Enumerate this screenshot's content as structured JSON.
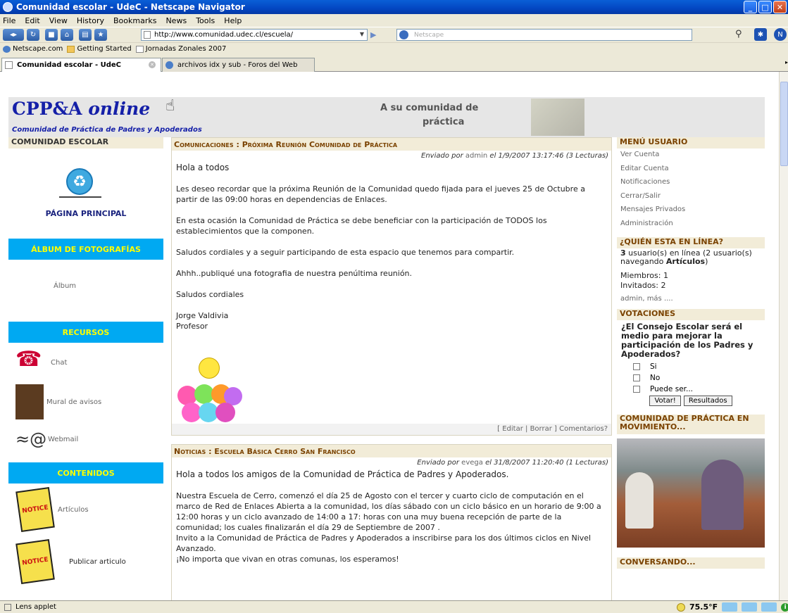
{
  "window": {
    "title": "Comunidad escolar - UdeC - Netscape Navigator"
  },
  "menu": [
    "File",
    "Edit",
    "View",
    "History",
    "Bookmarks",
    "News",
    "Tools",
    "Help"
  ],
  "address": {
    "url": "http://www.comunidad.udec.cl/escuela/",
    "search_placeholder": "Netscape"
  },
  "bookmarks": [
    {
      "label": "Netscape.com",
      "icon": "globe-icon"
    },
    {
      "label": "Getting Started",
      "icon": "folder-icon"
    },
    {
      "label": "Jornadas Zonales 2007",
      "icon": "page-icon"
    }
  ],
  "tabs": [
    {
      "label": "Comunidad escolar - UdeC",
      "active": true
    },
    {
      "label": "archivos idx y sub - Foros del Web",
      "active": false
    }
  ],
  "header": {
    "logo_main": "CPP&A",
    "logo_italic": "online",
    "logo_sub": "Comunidad de Práctica de Padres y Apoderados",
    "banner_line1": "A su comunidad de",
    "banner_line2": "práctica"
  },
  "left": {
    "heading": "COMUNIDAD ESCOLAR",
    "home_label": "PÁGINA PRINCIPAL",
    "album_section": "ÁLBUM DE FOTOGRAFÍAS",
    "album_link": "Álbum",
    "resources_section": "RECURSOS",
    "chat": "Chat",
    "mural": "Mural de avisos",
    "webmail": "Webmail",
    "contents_section": "CONTENIDOS",
    "articles": "Artículos",
    "publish": "Publicar articulo"
  },
  "posts": [
    {
      "title": "Comunicaciones : Próxima Reunión Comunidad de Práctica",
      "meta_prefix": "Enviado por",
      "author": "admin",
      "meta_suffix": "el 1/9/2007 13:17:46 (3 Lecturas)",
      "paragraphs": [
        "Hola a todos",
        "Les deseo recordar que la próxima Reunión de la Comunidad quedo fijada para el jueves 25 de Octubre a partir de las 09:00 horas en dependencias de Enlaces.",
        "En esta ocasión la Comunidad de Práctica se debe beneficiar con la participación de TODOS los establecimientos que la componen.",
        "Saludos cordiales y a seguir participando de esta espacio que tenemos para compartir.",
        "Ahhh..publiqué una fotografia de nuestra penúltima reunión.",
        "Saludos cordiales",
        "Jorge Valdivia",
        "Profesor"
      ],
      "footer": "[ Editar | Borrar ] Comentarios?"
    },
    {
      "title": "Noticias : Escuela Básica Cerro San Francisco",
      "meta_prefix": "Enviado por",
      "author": "evega",
      "meta_suffix": "el 31/8/2007 11:20:40 (1 Lecturas)",
      "paragraphs": [
        "Hola a todos los amigos de la Comunidad de Práctica de Padres y Apoderados.",
        "Nuestra Escuela de Cerro, comenzó el día 25 de Agosto con el tercer y cuarto ciclo de computación en el marco de Red de Enlaces Abierta a la comunidad, los días sábado con un ciclo básico en un horario de 9:00 a 12:00 horas y un ciclo avanzado de 14:00 a 17: horas con una muy buena recepción de parte de la comunidad; los cuales finalizarán el día 29 de Septiembre de 2007 .",
        "Invito a la Comunidad de Práctica de Padres y Apoderados a inscribirse para los dos últimos ciclos en Nivel Avanzado.",
        "¡No importa que vivan en otras comunas, los esperamos!"
      ]
    }
  ],
  "right": {
    "user_menu_title": "MENÚ USUARIO",
    "user_menu": [
      "Ver Cuenta",
      "Editar Cuenta",
      "Notificaciones",
      "Cerrar/Salir",
      "Mensajes Privados",
      "Administración"
    ],
    "online_title": "¿QUIÉN ESTA EN LÍNEA?",
    "online_line1_count": "3",
    "online_line1": "usuario(s) en línea (2 usuario(s) navegando",
    "online_line1_bold": "Artículos",
    "online_line1_end": ")",
    "members": "Miembros: 1",
    "guests": "Invitados: 2",
    "online_users": "admin, más ....",
    "votes_title": "VOTACIONES",
    "poll_question": "¿El Consejo Escolar será el medio para mejorar la participación de los Padres y Apoderados?",
    "poll_options": [
      "Si",
      "No",
      "Puede ser..."
    ],
    "vote_button": "Votar!",
    "results_button": "Resultados",
    "movement_title": "COMUNIDAD DE PRÁCTICA EN MOVIMIENTO...",
    "conversando_title": "CONVERSANDO..."
  },
  "status": {
    "text": "Lens applet",
    "temperature": "75.5°F"
  }
}
